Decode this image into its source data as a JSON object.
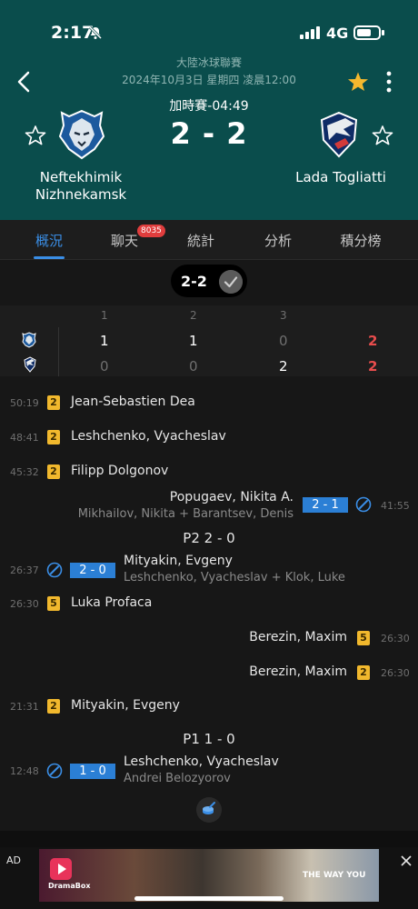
{
  "status": {
    "time": "2:17",
    "network": "4G"
  },
  "header": {
    "league": "大陸冰球聯賽",
    "date": "2024年10月3日 星期四 凌晨12:00",
    "period": "加時賽-04:49",
    "score": "2 - 2",
    "home_team": "Neftekhimik Nizhnekamsk",
    "away_team": "Lada Togliatti"
  },
  "tabs": [
    {
      "label": "概況",
      "active": true
    },
    {
      "label": "聊天",
      "badge": "8035"
    },
    {
      "label": "統計"
    },
    {
      "label": "分析"
    },
    {
      "label": "積分榜"
    }
  ],
  "score_pill": "2-2",
  "period_table": {
    "headers": [
      "1",
      "2",
      "3"
    ],
    "home": [
      "1",
      "1",
      "0",
      "2"
    ],
    "away": [
      "0",
      "0",
      "2",
      "2"
    ]
  },
  "events": {
    "e1": {
      "time": "50:19",
      "card": "2",
      "name": "Jean-Sebastien Dea"
    },
    "e2": {
      "time": "48:41",
      "card": "2",
      "name": "Leshchenko, Vyacheslav"
    },
    "e3": {
      "time": "45:32",
      "card": "2",
      "name": "Filipp Dolgonov"
    },
    "e4": {
      "time": "41:55",
      "score": "2 - 1",
      "name": "Popugaev, Nikita A.",
      "assist": "Mikhailov, Nikita + Barantsev, Denis"
    },
    "p2": "P2 2 - 0",
    "e5": {
      "time": "26:37",
      "score": "2 - 0",
      "name": "Mityakin, Evgeny",
      "assist": "Leshchenko, Vyacheslav + Klok, Luke"
    },
    "e6": {
      "time": "26:30",
      "card": "5",
      "name": "Luka Profaca"
    },
    "e7": {
      "time": "26:30",
      "card": "5",
      "name": "Berezin, Maxim"
    },
    "e8": {
      "time": "26:30",
      "card": "2",
      "name": "Berezin, Maxim"
    },
    "e9": {
      "time": "21:31",
      "card": "2",
      "name": "Mityakin, Evgeny"
    },
    "p1": "P1 1 - 0",
    "e10": {
      "time": "12:48",
      "score": "1 - 0",
      "name": "Leshchenko, Vyacheslav",
      "assist": "Andrei Belozyorov"
    }
  },
  "ad": {
    "label": "AD",
    "brand": "DramaBox",
    "slogan": "THE WAY YOU"
  },
  "colors": {
    "header_bg": "#0a4d4c",
    "accent_blue": "#3a8ee6",
    "total_red": "#e84d4d",
    "card_yellow": "#f1b82d",
    "star_gold": "#f5b82e"
  }
}
